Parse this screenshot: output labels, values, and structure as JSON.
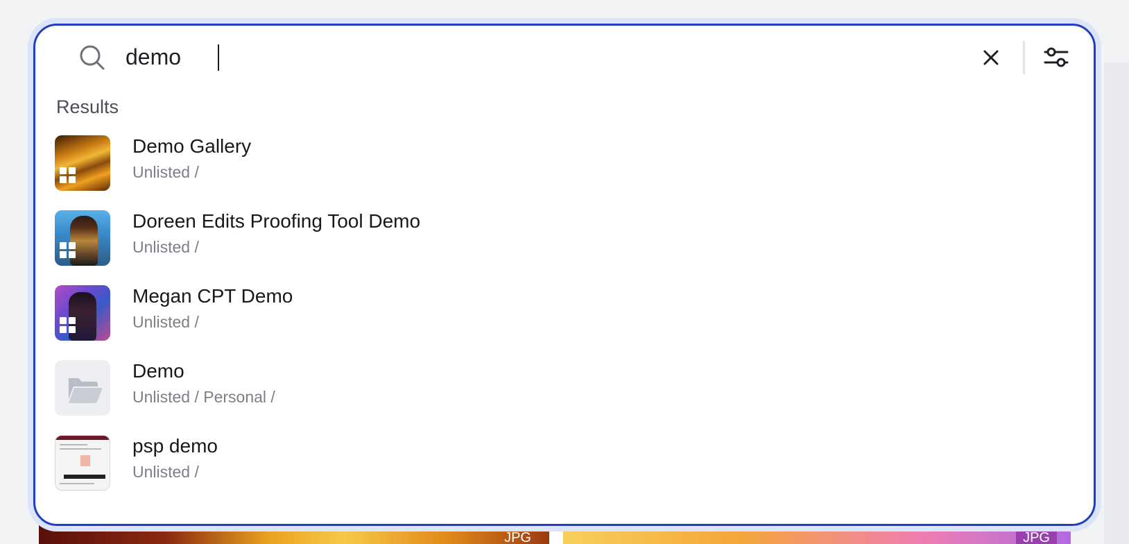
{
  "search": {
    "query": "demo",
    "clear_label": "Clear search",
    "filter_label": "Filters"
  },
  "results": {
    "heading": "Results",
    "items": [
      {
        "title": "Demo Gallery",
        "path": "Unlisted /",
        "type": "gallery"
      },
      {
        "title": "Doreen Edits Proofing Tool Demo",
        "path": "Unlisted /",
        "type": "gallery"
      },
      {
        "title": "Megan CPT Demo",
        "path": "Unlisted /",
        "type": "gallery"
      },
      {
        "title": "Demo",
        "path": "Unlisted / Personal /",
        "type": "folder"
      },
      {
        "title": "psp demo",
        "path": "Unlisted /",
        "type": "gallery"
      }
    ]
  },
  "background": {
    "tile_badges": [
      "JPG",
      "JPG"
    ]
  },
  "icons": {
    "search": "search-icon",
    "clear": "close-icon",
    "filter": "sliders-icon",
    "gallery": "grid-icon",
    "folder": "folder-icon"
  },
  "colors": {
    "focus_border": "#1f3fbf",
    "focus_ring": "#dbe4fb",
    "subtext": "#7a7f88"
  }
}
